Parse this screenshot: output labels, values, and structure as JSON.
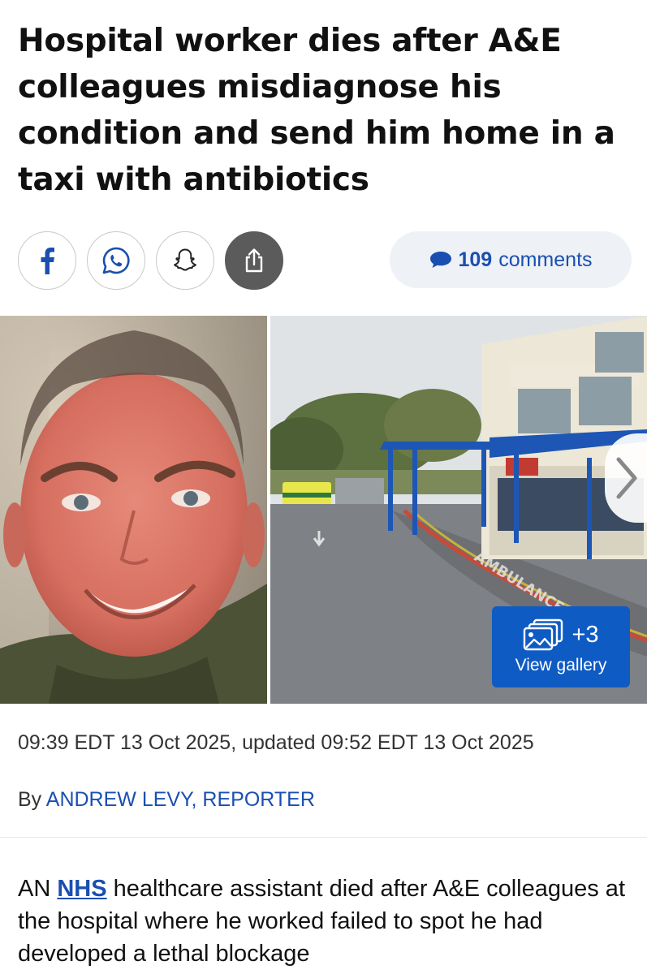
{
  "article": {
    "headline": "Hospital worker dies after A&E colleagues misdiagnose his condition and send him home in a taxi with antibiotics",
    "timestamp": "09:39 EDT 13 Oct 2025, updated 09:52 EDT 13 Oct 2025",
    "byline_prefix": "By",
    "author": "ANDREW LEVY, REPORTER",
    "body_start": "AN",
    "body_link": "NHS",
    "body_rest": "healthcare assistant died after A&E colleagues at the hospital where he worked failed to spot he had developed a lethal blockage"
  },
  "share": {
    "buttons": [
      {
        "name": "facebook-share-button",
        "icon": "facebook-icon"
      },
      {
        "name": "whatsapp-share-button",
        "icon": "whatsapp-icon"
      },
      {
        "name": "snapchat-share-button",
        "icon": "snapchat-icon"
      },
      {
        "name": "share-button",
        "icon": "share-icon"
      }
    ],
    "comments_count": "109",
    "comments_label": "comments"
  },
  "gallery": {
    "extra_count": "+3",
    "label": "View gallery",
    "road_marking": "AMBULANCES"
  },
  "colors": {
    "link_blue": "#1a4fb0",
    "gallery_blue": "#0f5bc4",
    "pill_bg": "#eef1f5"
  }
}
